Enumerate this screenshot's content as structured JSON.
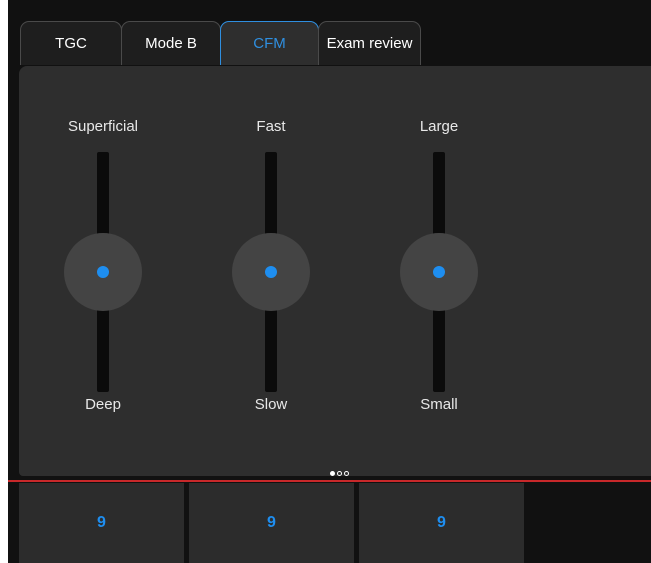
{
  "tabs": [
    {
      "label": "TGC",
      "active": false
    },
    {
      "label": "Mode B",
      "active": false
    },
    {
      "label": "CFM",
      "active": true
    },
    {
      "label": "Exam review",
      "active": false
    }
  ],
  "sliders": [
    {
      "top_label": "Superficial",
      "bottom_label": "Deep",
      "level": 0.5
    },
    {
      "top_label": "Fast",
      "bottom_label": "Slow",
      "level": 0.5
    },
    {
      "top_label": "Large",
      "bottom_label": "Small",
      "level": 0.5
    }
  ],
  "pager": {
    "pages": 3,
    "current": 1
  },
  "value_buttons": [
    {
      "value": "9"
    },
    {
      "value": "9"
    },
    {
      "value": "9"
    }
  ],
  "colors": {
    "accent": "#1e8ef0",
    "active_tab": "#2f8fe0",
    "divider": "#c8282a",
    "panel": "#2e2e2e",
    "background": "#111111"
  }
}
